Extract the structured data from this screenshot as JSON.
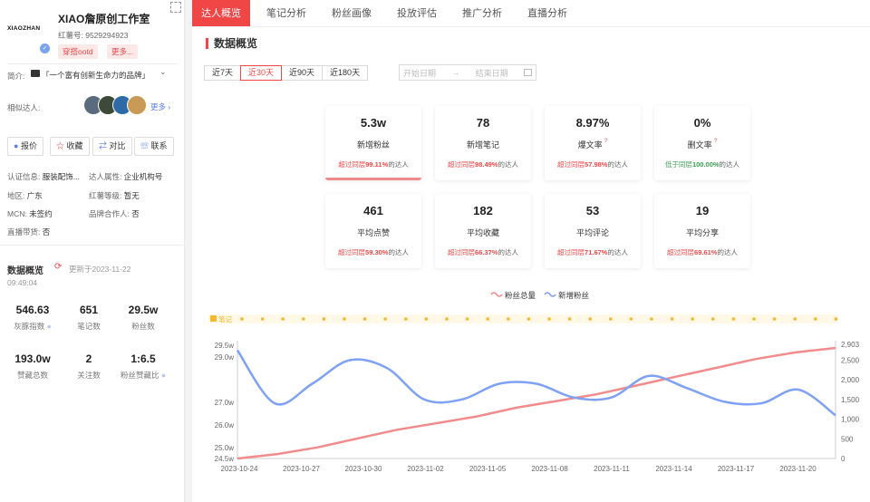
{
  "profile": {
    "name": "XIAO詹原创工作室",
    "logo_text": "XIAOZHAN",
    "red_id": "红薯号: 9529294923",
    "tag": "穿搭ootd",
    "more_tag": "更多...",
    "intro_label": "简介:",
    "intro_text": "「一个富有创新生命力的品牌」",
    "similar_label": "相似达人:",
    "similar_more": "更多",
    "buttons": [
      "报价",
      "收藏",
      "对比",
      "联系"
    ],
    "info": [
      {
        "k": "认证信息:",
        "v": "服装配饰..."
      },
      {
        "k": "达人属性:",
        "v": "企业机构号"
      },
      {
        "k": "地区:",
        "v": "广东"
      },
      {
        "k": "红薯等级:",
        "v": "暂无"
      },
      {
        "k": "MCN:",
        "v": "未签约"
      },
      {
        "k": "品牌合作人:",
        "v": "否"
      },
      {
        "k": "直播带货:",
        "v": "否"
      }
    ],
    "overview_title": "数据概览",
    "update_time": "更新于2023-11-22",
    "update_time2": "09:49:04",
    "stats": [
      {
        "n": "546.63",
        "t": "灰豚指数"
      },
      {
        "n": "651",
        "t": "笔记数"
      },
      {
        "n": "29.5w",
        "t": "粉丝数"
      },
      {
        "n": "193.0w",
        "t": "赞藏总数"
      },
      {
        "n": "2",
        "t": "关注数"
      },
      {
        "n": "1:6.5",
        "t": "粉丝赞藏比"
      }
    ]
  },
  "tabs": [
    "达人概览",
    "笔记分析",
    "粉丝画像",
    "投放评估",
    "推广分析",
    "直播分析"
  ],
  "section_title": "数据概览",
  "ranges": [
    "近7天",
    "近30天",
    "近90天",
    "近180天"
  ],
  "date_start": "开始日期",
  "date_arrow": "→",
  "date_end": "结束日期",
  "cards": [
    {
      "v": "5.3w",
      "l": "新增粉丝",
      "pre": "超过同层",
      "pct": "99.11%",
      "post": "的达人"
    },
    {
      "v": "78",
      "l": "新增笔记",
      "pre": "超过同层",
      "pct": "98.49%",
      "post": "的达人"
    },
    {
      "v": "8.97%",
      "l": "爆文率",
      "pre": "超过同层",
      "pct": "57.98%",
      "post": "的达人"
    },
    {
      "v": "0%",
      "l": "删文率",
      "pre": "低于同层",
      "pct": "100.00%",
      "post": "的达人"
    },
    {
      "v": "461",
      "l": "平均点赞",
      "pre": "超过同层",
      "pct": "59.30%",
      "post": "的达人"
    },
    {
      "v": "182",
      "l": "平均收藏",
      "pre": "超过同层",
      "pct": "66.37%",
      "post": "的达人"
    },
    {
      "v": "53",
      "l": "平均评论",
      "pre": "超过同层",
      "pct": "71.67%",
      "post": "的达人"
    },
    {
      "v": "19",
      "l": "平均分享",
      "pre": "超过同层",
      "pct": "69.61%",
      "post": "的达人"
    }
  ],
  "colors": {
    "accent": "#f04646",
    "total_line": "#f28c8c",
    "new_line": "#7ea1f5",
    "note_dot": "#f5b82e"
  },
  "chart_data": {
    "type": "line",
    "legend": [
      "粉丝总量",
      "新增粉丝"
    ],
    "legend_position": "top-center",
    "note_label": "笔记",
    "x": [
      "2023-10-24",
      "2023-10-27",
      "2023-10-30",
      "2023-11-02",
      "2023-11-05",
      "2023-11-08",
      "2023-11-11",
      "2023-11-14",
      "2023-11-17",
      "2023-11-20"
    ],
    "left_ticks": [
      "29.5w",
      "29.0w",
      "27.0w",
      "26.0w",
      "25.0w",
      "24.5w"
    ],
    "right_ticks": [
      "2,903",
      "2,500",
      "2,000",
      "1,500",
      "1,000",
      "500",
      "0"
    ],
    "series": [
      {
        "name": "粉丝总量",
        "axis": "left",
        "values": [
          24.5,
          24.7,
          25.0,
          25.4,
          25.8,
          26.1,
          26.4,
          26.8,
          27.1,
          27.4,
          27.8,
          28.2,
          28.6,
          29.0,
          29.3,
          29.5
        ]
      },
      {
        "name": "新增粉丝",
        "axis": "right",
        "values": [
          2750,
          1400,
          1900,
          2500,
          2300,
          1500,
          1500,
          1900,
          1900,
          1550,
          1550,
          2100,
          1800,
          1450,
          1400,
          1750,
          1100
        ]
      }
    ]
  }
}
